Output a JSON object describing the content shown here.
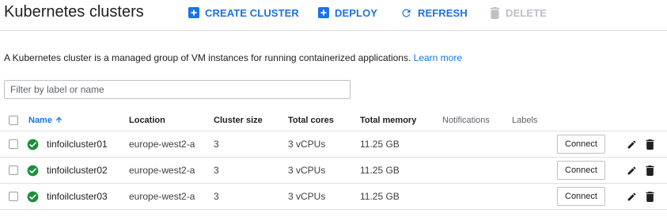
{
  "header": {
    "title": "Kubernetes clusters",
    "actions": {
      "create": "CREATE CLUSTER",
      "deploy": "DEPLOY",
      "refresh": "REFRESH",
      "delete": "DELETE"
    }
  },
  "description": {
    "text": "A Kubernetes cluster is a managed group of VM instances for running containerized applications.",
    "link": "Learn more"
  },
  "filter": {
    "placeholder": "Filter by label or name",
    "value": ""
  },
  "table": {
    "columns": {
      "name": "Name",
      "location": "Location",
      "size": "Cluster size",
      "cores": "Total cores",
      "memory": "Total memory",
      "notifications": "Notifications",
      "labels": "Labels"
    },
    "sort": {
      "column": "name",
      "direction": "ascending"
    },
    "rows": [
      {
        "name": "tinfoilcluster01",
        "location": "europe-west2-a",
        "size": "3",
        "cores": "3 vCPUs",
        "memory": "11.25 GB",
        "status": "ok",
        "connect": "Connect"
      },
      {
        "name": "tinfoilcluster02",
        "location": "europe-west2-a",
        "size": "3",
        "cores": "3 vCPUs",
        "memory": "11.25 GB",
        "status": "ok",
        "connect": "Connect"
      },
      {
        "name": "tinfoilcluster03",
        "location": "europe-west2-a",
        "size": "3",
        "cores": "3 vCPUs",
        "memory": "11.25 GB",
        "status": "ok",
        "connect": "Connect"
      }
    ]
  },
  "colors": {
    "accent": "#1a73e8",
    "status_ok": "#1e8e3e",
    "disabled": "#bdc1c6",
    "text": "#202124"
  },
  "icons": {
    "create": "add-box-icon",
    "deploy": "add-box-icon",
    "refresh": "refresh-icon",
    "delete": "trash-icon",
    "sort": "arrow-up-icon",
    "status": "check-circle-icon",
    "edit": "pencil-icon",
    "row_delete": "trash-icon"
  }
}
